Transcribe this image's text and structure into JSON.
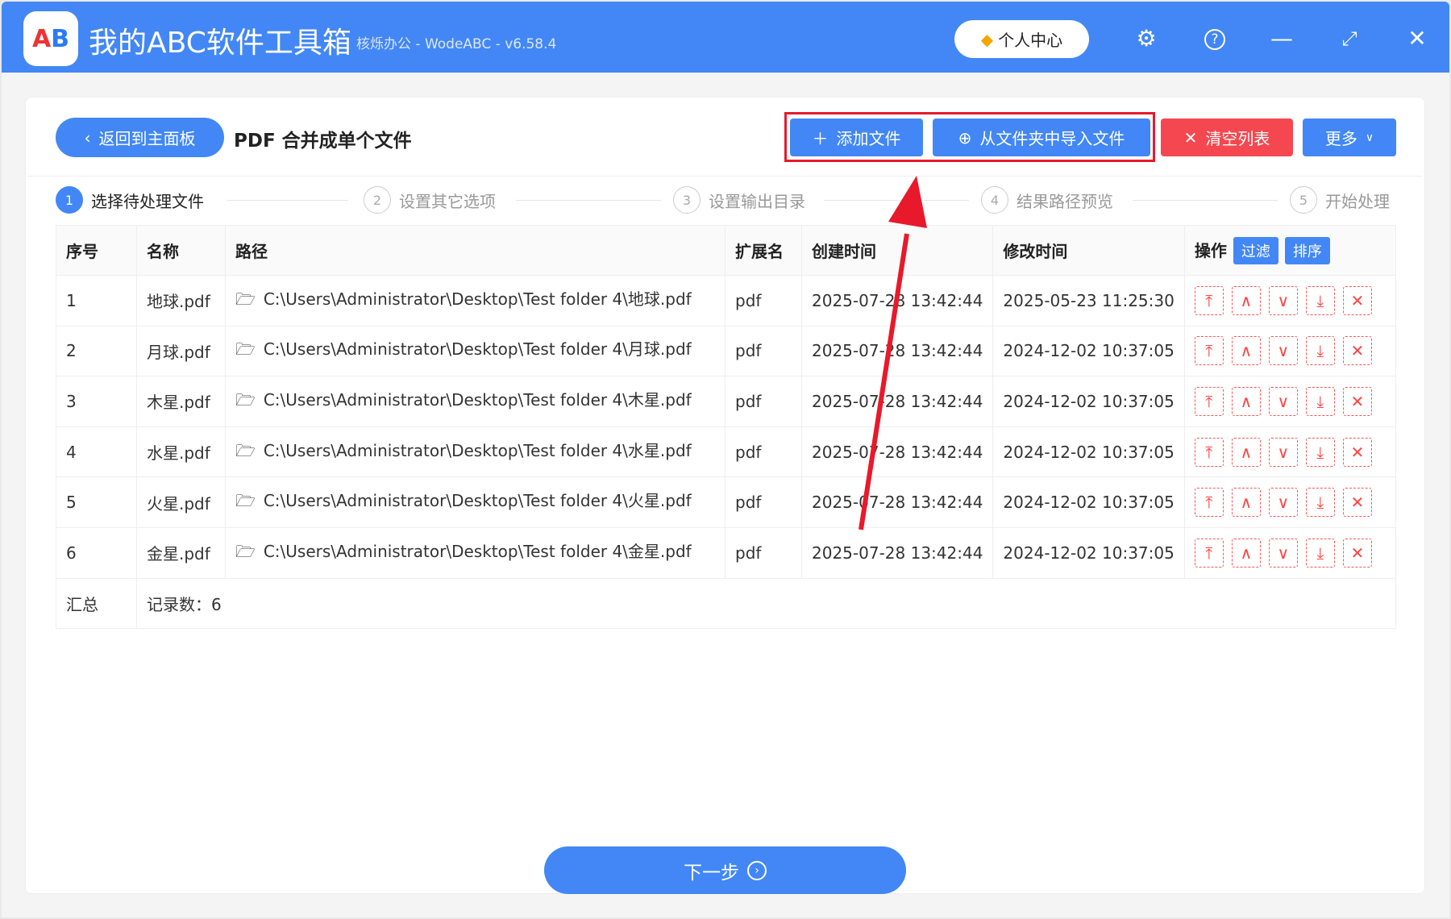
{
  "app": {
    "title": "我的ABC软件工具箱",
    "subtitle": "核烁办公 - WodeABC - v6.58.4",
    "logo_text": "AB",
    "vip_label": "个人中心"
  },
  "toolbar": {
    "back_label": "返回到主面板",
    "page_title": "PDF 合并成单个文件",
    "add_file": "添加文件",
    "import_folder": "从文件夹中导入文件",
    "clear_list": "清空列表",
    "more": "更多"
  },
  "steps": [
    {
      "num": "1",
      "label": "选择待处理文件"
    },
    {
      "num": "2",
      "label": "设置其它选项"
    },
    {
      "num": "3",
      "label": "设置输出目录"
    },
    {
      "num": "4",
      "label": "结果路径预览"
    },
    {
      "num": "5",
      "label": "开始处理"
    }
  ],
  "table": {
    "headers": {
      "index": "序号",
      "name": "名称",
      "path": "路径",
      "ext": "扩展名",
      "created": "创建时间",
      "modified": "修改时间",
      "ops": "操作",
      "filter": "过滤",
      "sort": "排序"
    },
    "rows": [
      {
        "index": "1",
        "name": "地球.pdf",
        "path": "C:\\Users\\Administrator\\Desktop\\Test folder 4\\地球.pdf",
        "ext": "pdf",
        "created": "2025-07-28 13:42:44",
        "modified": "2025-05-23 11:25:30"
      },
      {
        "index": "2",
        "name": "月球.pdf",
        "path": "C:\\Users\\Administrator\\Desktop\\Test folder 4\\月球.pdf",
        "ext": "pdf",
        "created": "2025-07-28 13:42:44",
        "modified": "2024-12-02 10:37:05"
      },
      {
        "index": "3",
        "name": "木星.pdf",
        "path": "C:\\Users\\Administrator\\Desktop\\Test folder 4\\木星.pdf",
        "ext": "pdf",
        "created": "2025-07-28 13:42:44",
        "modified": "2024-12-02 10:37:05"
      },
      {
        "index": "4",
        "name": "水星.pdf",
        "path": "C:\\Users\\Administrator\\Desktop\\Test folder 4\\水星.pdf",
        "ext": "pdf",
        "created": "2025-07-28 13:42:44",
        "modified": "2024-12-02 10:37:05"
      },
      {
        "index": "5",
        "name": "火星.pdf",
        "path": "C:\\Users\\Administrator\\Desktop\\Test folder 4\\火星.pdf",
        "ext": "pdf",
        "created": "2025-07-28 13:42:44",
        "modified": "2024-12-02 10:37:05"
      },
      {
        "index": "6",
        "name": "金星.pdf",
        "path": "C:\\Users\\Administrator\\Desktop\\Test folder 4\\金星.pdf",
        "ext": "pdf",
        "created": "2025-07-28 13:42:44",
        "modified": "2024-12-02 10:37:05"
      }
    ],
    "summary_label": "汇总",
    "summary_value": "记录数：6"
  },
  "footer": {
    "next_label": "下一步"
  },
  "colors": {
    "primary": "#4287f5",
    "danger": "#f5474f",
    "highlight": "#e8192b"
  }
}
